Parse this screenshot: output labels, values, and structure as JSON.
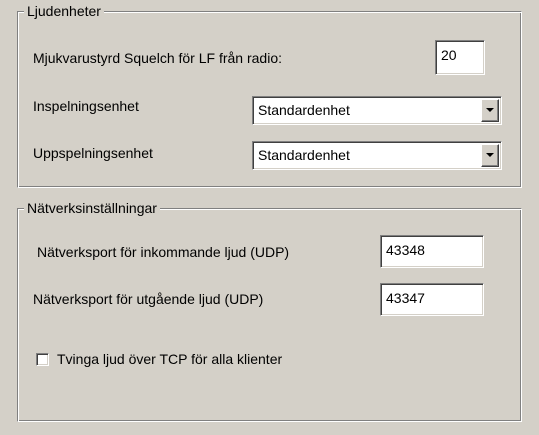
{
  "audio_devices": {
    "title": "Ljudenheter",
    "squelch": {
      "label": "Mjukvarustyrd Squelch för LF från radio:",
      "value": "20"
    },
    "recording": {
      "label": "Inspelningsenhet",
      "selected": "Standardenhet"
    },
    "playback": {
      "label": "Uppspelningsenhet",
      "selected": "Standardenhet"
    }
  },
  "network_settings": {
    "title": "Nätverksinställningar",
    "incoming_port": {
      "label": "Nätverksport för inkommande ljud (UDP)",
      "value": "43348"
    },
    "outgoing_port": {
      "label": "Nätverksport för utgående ljud (UDP)",
      "value": "43347"
    },
    "force_tcp": {
      "label": "Tvinga ljud över TCP för alla klienter",
      "checked": false
    }
  }
}
